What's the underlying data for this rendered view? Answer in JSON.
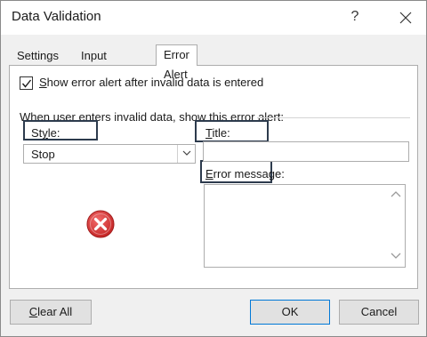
{
  "window": {
    "title": "Data Validation",
    "help_label": "?"
  },
  "tabs": [
    {
      "label": "Settings",
      "active": false
    },
    {
      "label": "Input Message",
      "active": false
    },
    {
      "label": "Error Alert",
      "active": true
    }
  ],
  "error_alert": {
    "show_checkbox_checked": true,
    "show_checkbox_prefix": "S",
    "show_checkbox_rest": "how error alert after invalid data is entered",
    "group_label": "When user enters invalid data, show this error alert:",
    "style_label_prefix": "St",
    "style_label_u": "y",
    "style_label_rest": "le:",
    "style_value": "Stop",
    "title_label_u": "T",
    "title_label_rest": "itle:",
    "title_value": "",
    "message_label_u": "E",
    "message_label_rest": "rror message:",
    "message_value": "",
    "icon": "error-stop-icon"
  },
  "buttons": {
    "clear_u": "C",
    "clear_rest": "lear All",
    "ok": "OK",
    "cancel": "Cancel"
  },
  "colors": {
    "highlight_border": "#2d3b4d",
    "error_icon": "#d32f2f",
    "ok_border": "#0078d7"
  }
}
